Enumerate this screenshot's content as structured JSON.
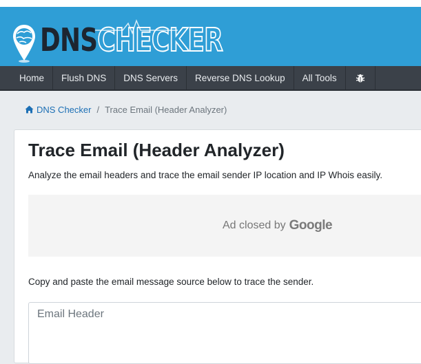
{
  "header": {
    "logo_dns": "DNS",
    "logo_checker": "CHECKER"
  },
  "nav": {
    "items": [
      {
        "label": "Home"
      },
      {
        "label": "Flush DNS"
      },
      {
        "label": "DNS Servers"
      },
      {
        "label": "Reverse DNS Lookup"
      },
      {
        "label": "All Tools"
      }
    ],
    "extra_icon": "bug-icon"
  },
  "breadcrumb": {
    "home_label": "DNS Checker",
    "separator": "/",
    "current": "Trace Email (Header Analyzer)"
  },
  "main": {
    "title": "Trace Email (Header Analyzer)",
    "subtitle": "Analyze the email headers and trace the email sender IP location and IP Whois easily.",
    "ad_text": "Ad closed by",
    "ad_brand": "Google",
    "instructions": "Copy and paste the email message source below to trace the sender.",
    "header_input": {
      "value": "",
      "placeholder": "Email Header"
    }
  },
  "colors": {
    "header_bg": "#2f9ed6",
    "nav_bg": "#3b4149",
    "link": "#1c6fb5"
  }
}
